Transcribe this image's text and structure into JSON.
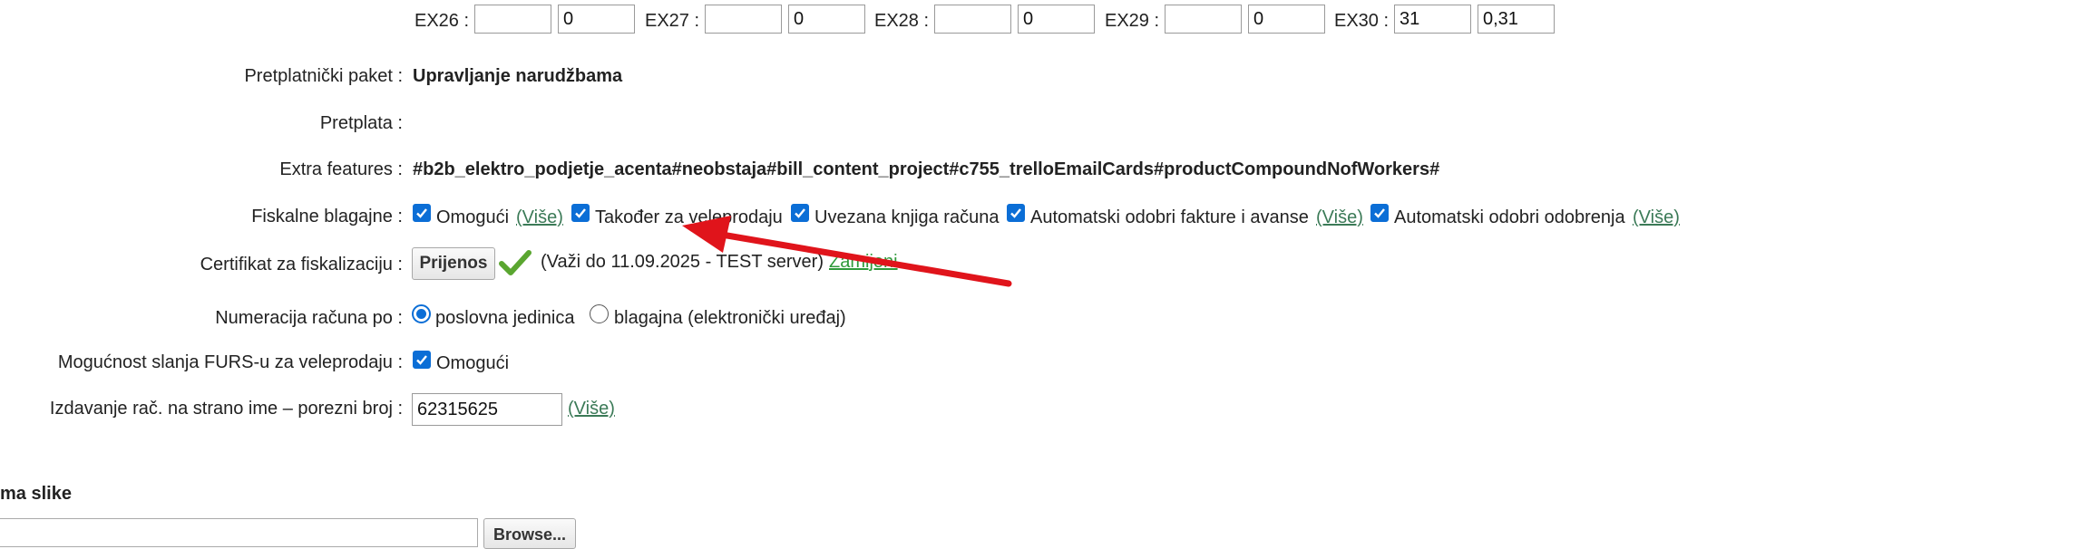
{
  "ex_fields": [
    {
      "label": "EX26 :",
      "value1": "",
      "value2": "0"
    },
    {
      "label": "EX27 :",
      "value1": "",
      "value2": "0"
    },
    {
      "label": "EX28 :",
      "value1": "",
      "value2": "0"
    },
    {
      "label": "EX29 :",
      "value1": "",
      "value2": "0"
    },
    {
      "label": "EX30 :",
      "value1": "31",
      "value2": "0,31"
    }
  ],
  "package": {
    "label": "Pretplatnički paket :",
    "value": "Upravljanje narudžbama"
  },
  "subscription": {
    "label": "Pretplata :",
    "value": ""
  },
  "extra_features": {
    "label": "Extra features :",
    "value": "#b2b_elektro_podjetje_acenta#neobstaja#bill_content_project#c755_trelloEmailCards#productCompoundNofWorkers#"
  },
  "fiscal": {
    "label": "Fiskalne blagajne :",
    "enable": "Omogući",
    "enable_more": "(Više)",
    "wholesale": "Također za veleprodaju",
    "bound_book": "Uvezana knjiga računa",
    "auto_invoices": "Automatski odobri fakture i avanse",
    "auto_invoices_more": "(Više)",
    "auto_approvals": "Automatski odobri odobrenja",
    "auto_approvals_more": "(Više)"
  },
  "certificate": {
    "label": "Certifikat za fiskalizaciju :",
    "upload_button": "Prijenos",
    "validity": "(Važi do 11.09.2025 - TEST server)",
    "change_link": "Zamijeni"
  },
  "numbering": {
    "label": "Numeracija računa po :",
    "option1": "poslovna jedinica",
    "option2": "blagajna (elektronički uređaj)",
    "selected": "poslovna jedinica"
  },
  "furs": {
    "label": "Mogućnost slanja FURS-u za veleprodaju :",
    "enable": "Omogući"
  },
  "foreign": {
    "label": "Izdavanje rač. na strano ime – porezni broj :",
    "value": "62315625",
    "more": "(Više)"
  },
  "image_section": {
    "title": "ma slike",
    "browse_button": "Browse..."
  },
  "colors": {
    "checkbox": "#0b6ed6",
    "link": "#3b7a57",
    "arrow": "#e0141b",
    "check": "#5aa630"
  },
  "icons": {
    "checkmark": "green-checkmark-icon"
  }
}
